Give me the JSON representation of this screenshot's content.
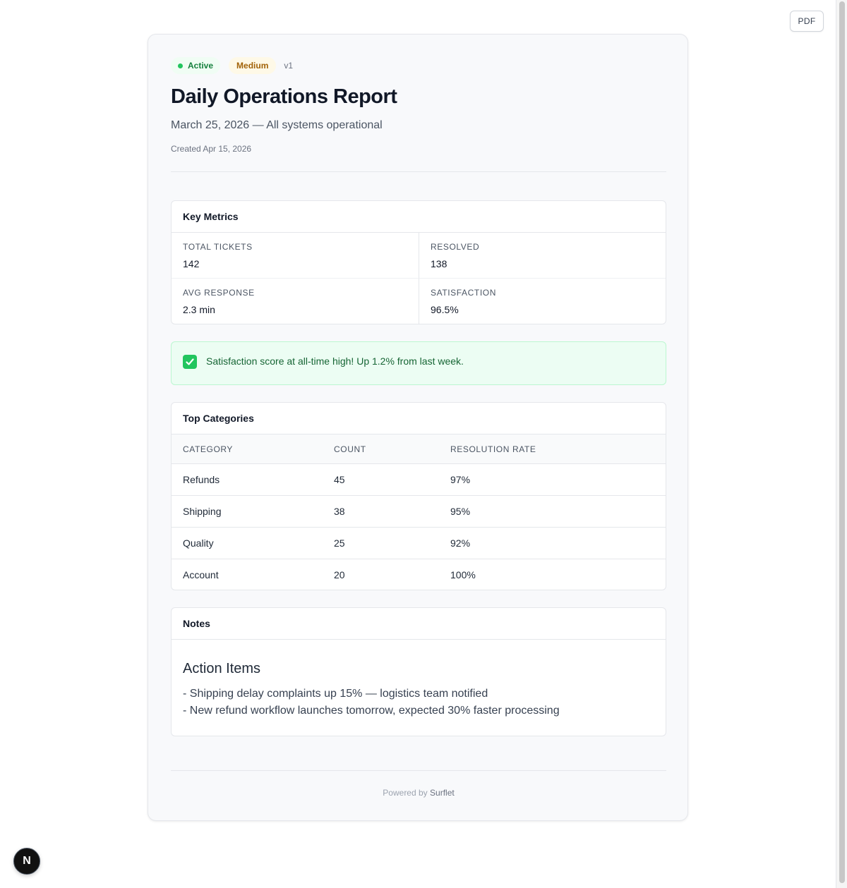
{
  "toolbar": {
    "pdf_label": "PDF"
  },
  "report": {
    "status_badge": "Active",
    "priority_badge": "Medium",
    "version": "v1",
    "title": "Daily Operations Report",
    "subtitle": "March 25, 2026 — All systems operational",
    "created": "Created Apr 15, 2026"
  },
  "metrics": {
    "title": "Key Metrics",
    "items": [
      {
        "label": "Total Tickets",
        "value": "142"
      },
      {
        "label": "Resolved",
        "value": "138"
      },
      {
        "label": "Avg Response",
        "value": "2.3 min"
      },
      {
        "label": "Satisfaction",
        "value": "96.5%"
      }
    ]
  },
  "alert": {
    "icon": "check-icon",
    "text": "Satisfaction score at all-time high! Up 1.2% from last week."
  },
  "categories": {
    "title": "Top Categories",
    "headers": [
      "CATEGORY",
      "COUNT",
      "RESOLUTION RATE"
    ],
    "rows": [
      [
        "Refunds",
        "45",
        "97%"
      ],
      [
        "Shipping",
        "38",
        "95%"
      ],
      [
        "Quality",
        "25",
        "92%"
      ],
      [
        "Account",
        "20",
        "100%"
      ]
    ]
  },
  "notes": {
    "title": "Notes",
    "heading": "Action Items",
    "lines": [
      "- Shipping delay complaints up 15% — logistics team notified",
      "- New refund workflow launches tomorrow, expected 30% faster processing"
    ]
  },
  "footer": {
    "prefix": "Powered by",
    "brand": "Surflet"
  },
  "avatar": {
    "initial": "N"
  },
  "colors": {
    "active": "#15803d",
    "medium": "#a16207",
    "success_bg": "#ecfdf3"
  }
}
